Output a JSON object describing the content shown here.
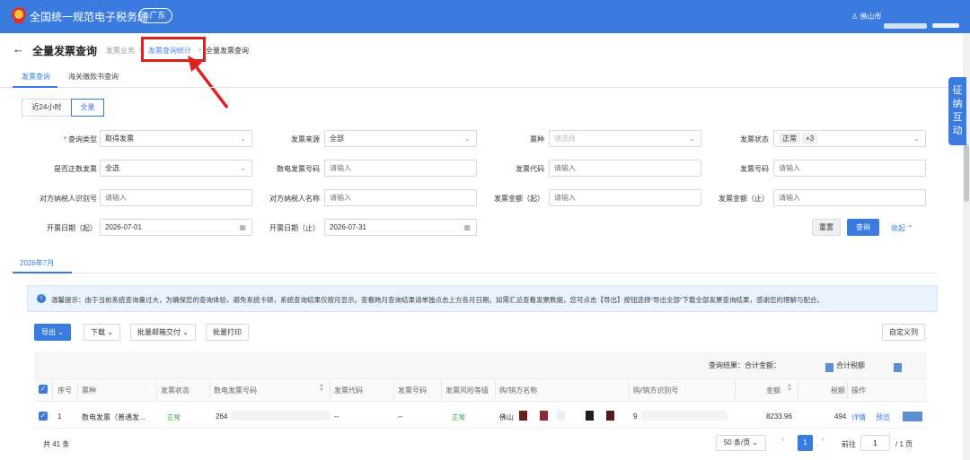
{
  "app": {
    "title": "全国统一规范电子税务局",
    "region": "广东",
    "user": "佛山市"
  },
  "page": {
    "title": "全量发票查询"
  },
  "breadcrumb": {
    "item1": "发票业务",
    "item2": "发票查询统计",
    "item3": "全量发票查询",
    "sep": ">"
  },
  "tabs": [
    "发票查询",
    "海关缴款书查询"
  ],
  "time_filter": [
    "近24小时",
    "全量"
  ],
  "form": {
    "query_type": {
      "label": "查询类型",
      "value": "取得发票"
    },
    "source": {
      "label": "发票来源",
      "value": "全部"
    },
    "invoice_kind": {
      "label": "票种",
      "placeholder": "请选择"
    },
    "status": {
      "label": "发票状态",
      "tag1": "正常",
      "tag2": "+3"
    },
    "positive": {
      "label": "是否正数发票",
      "value": "全选"
    },
    "e_number": {
      "label": "数电发票号码",
      "placeholder": "请输入"
    },
    "code": {
      "label": "发票代码",
      "placeholder": "请输入"
    },
    "number": {
      "label": "发票号码",
      "placeholder": "请输入"
    },
    "tax_id": {
      "label": "对方纳税人识别号",
      "placeholder": "请输入"
    },
    "tax_name": {
      "label": "对方纳税人名称",
      "placeholder": "请输入"
    },
    "amount_from": {
      "label": "发票金额（起）",
      "placeholder": "请输入"
    },
    "amount_to": {
      "label": "发票金额（止）",
      "placeholder": "请输入"
    },
    "date_from": {
      "label": "开票日期（起）",
      "value": "2026-07-01"
    },
    "date_to": {
      "label": "开票日期（止）",
      "value": "2026-07-31"
    }
  },
  "actions": {
    "reset": "重置",
    "query": "查询",
    "collapse": "收起"
  },
  "month_tab": "2026年7月",
  "notice": "温馨提示：由于当前系统查询量过大，为确保您的查询体验，避免系统卡顿，系统查询结果仅按月显示。查看跨月查询结果请单独点击上方各月日期。如需汇总查看发票数据，您可点击【导出】按钮选择“导出全部”下载全部发票查询结果，感谢您的理解与配合。",
  "toolbar": {
    "export": "导出",
    "download": "下载",
    "batch_mail": "批量邮箱交付",
    "batch_print": "批量打印",
    "custom_cols": "自定义列"
  },
  "summary": {
    "result": "查询结果：合计金额：",
    "total_tax": "合计税额"
  },
  "table": {
    "columns": [
      "序号",
      "票种",
      "发票状态",
      "数电发票号码",
      "发票代码",
      "发票号码",
      "发票风险等级",
      "购/销方名称",
      "购/销方识别号",
      "金额",
      "税额",
      "操作"
    ],
    "rows": [
      {
        "index": "1",
        "kind": "数电发票（普通发...",
        "status": "正常",
        "e_number": "264",
        "code": "--",
        "number": "--",
        "risk": "正常",
        "name": "佛山",
        "tax_id": "9",
        "amount": "8233.96",
        "tax": "494",
        "op_detail": "详情",
        "op_preview": "预览"
      }
    ]
  },
  "pager": {
    "total": "共 41 条",
    "page_size": "50 条/页",
    "prev": "‹",
    "current": "1",
    "next": "›",
    "goto_label": "前往",
    "goto_value": "1",
    "pages": "/ 1 页"
  },
  "side_widget": "征纳互动",
  "colors": {
    "primary": "#3a7be0",
    "highlight_box": "#e02020",
    "ok_status": "#2ea043"
  }
}
